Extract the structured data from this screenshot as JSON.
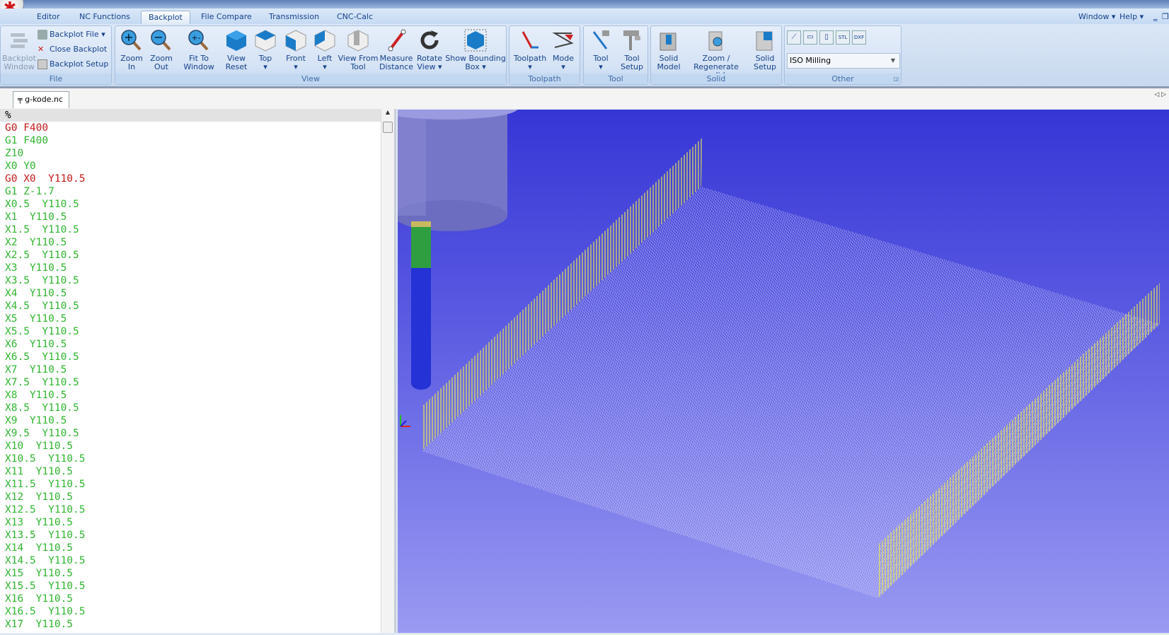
{
  "ribbon_tabs": [
    {
      "label": "Editor"
    },
    {
      "label": "NC Functions"
    },
    {
      "label": "Backplot"
    },
    {
      "label": "File Compare"
    },
    {
      "label": "Transmission"
    },
    {
      "label": "CNC-Calc"
    }
  ],
  "active_tab": "Backplot",
  "menu_right": {
    "window": "Window",
    "help": "Help"
  },
  "file_group": {
    "label": "File",
    "backplot_window": "Backplot Window",
    "backplot_file": "Backplot File",
    "close_backplot": "Close Backplot",
    "backplot_setup": "Backplot Setup"
  },
  "view_group": {
    "label": "View",
    "buttons": [
      {
        "label": "Zoom In"
      },
      {
        "label": "Zoom Out"
      },
      {
        "label": "Fit To Window"
      },
      {
        "label": "View Reset"
      },
      {
        "label": "Top"
      },
      {
        "label": "Front"
      },
      {
        "label": "Left"
      },
      {
        "label": "View From Tool"
      },
      {
        "label": "Measure Distance"
      },
      {
        "label": "Rotate View"
      },
      {
        "label": "Show Bounding Box"
      }
    ]
  },
  "toolpath_group": {
    "label": "Toolpath",
    "buttons": [
      {
        "label": "Toolpath"
      },
      {
        "label": "Mode"
      }
    ]
  },
  "tool_group": {
    "label": "Tool",
    "buttons": [
      {
        "label": "Tool"
      },
      {
        "label": "Tool Setup"
      }
    ]
  },
  "solid_group": {
    "label": "Solid",
    "buttons": [
      {
        "label": "Solid Model"
      },
      {
        "label": "Zoom / Regenerate solid"
      },
      {
        "label": "Solid Setup"
      }
    ]
  },
  "other_group": {
    "label": "Other",
    "mode_select": "ISO Milling",
    "icons": [
      "line-icon",
      "box-icon",
      "page-icon",
      "stl-icon",
      "dxf-icon"
    ]
  },
  "document_tab": "g-kode.nc",
  "colors": {
    "rapid": "#c41a1a",
    "feed": "#2fb52f",
    "viewport_top": "#3636d6",
    "viewport_bottom": "#9a9af2",
    "wall": "#e8e850"
  },
  "code_lines": [
    {
      "text": "%",
      "type": "plain"
    },
    {
      "text": "G0 F400",
      "type": "rapid"
    },
    {
      "text": "G1 F400",
      "type": "feed"
    },
    {
      "text": "Z10",
      "type": "feed"
    },
    {
      "text": "X0 Y0",
      "type": "feed"
    },
    {
      "text": "G0 X0  Y110.5",
      "type": "rapid"
    },
    {
      "text": "G1 Z-1.7",
      "type": "feed"
    },
    {
      "text": "X0.5  Y110.5",
      "type": "feed"
    },
    {
      "text": "X1  Y110.5",
      "type": "feed"
    },
    {
      "text": "X1.5  Y110.5",
      "type": "feed"
    },
    {
      "text": "X2  Y110.5",
      "type": "feed"
    },
    {
      "text": "X2.5  Y110.5",
      "type": "feed"
    },
    {
      "text": "X3  Y110.5",
      "type": "feed"
    },
    {
      "text": "X3.5  Y110.5",
      "type": "feed"
    },
    {
      "text": "X4  Y110.5",
      "type": "feed"
    },
    {
      "text": "X4.5  Y110.5",
      "type": "feed"
    },
    {
      "text": "X5  Y110.5",
      "type": "feed"
    },
    {
      "text": "X5.5  Y110.5",
      "type": "feed"
    },
    {
      "text": "X6  Y110.5",
      "type": "feed"
    },
    {
      "text": "X6.5  Y110.5",
      "type": "feed"
    },
    {
      "text": "X7  Y110.5",
      "type": "feed"
    },
    {
      "text": "X7.5  Y110.5",
      "type": "feed"
    },
    {
      "text": "X8  Y110.5",
      "type": "feed"
    },
    {
      "text": "X8.5  Y110.5",
      "type": "feed"
    },
    {
      "text": "X9  Y110.5",
      "type": "feed"
    },
    {
      "text": "X9.5  Y110.5",
      "type": "feed"
    },
    {
      "text": "X10  Y110.5",
      "type": "feed"
    },
    {
      "text": "X10.5  Y110.5",
      "type": "feed"
    },
    {
      "text": "X11  Y110.5",
      "type": "feed"
    },
    {
      "text": "X11.5  Y110.5",
      "type": "feed"
    },
    {
      "text": "X12  Y110.5",
      "type": "feed"
    },
    {
      "text": "X12.5  Y110.5",
      "type": "feed"
    },
    {
      "text": "X13  Y110.5",
      "type": "feed"
    },
    {
      "text": "X13.5  Y110.5",
      "type": "feed"
    },
    {
      "text": "X14  Y110.5",
      "type": "feed"
    },
    {
      "text": "X14.5  Y110.5",
      "type": "feed"
    },
    {
      "text": "X15  Y110.5",
      "type": "feed"
    },
    {
      "text": "X15.5  Y110.5",
      "type": "feed"
    },
    {
      "text": "X16  Y110.5",
      "type": "feed"
    },
    {
      "text": "X16.5  Y110.5",
      "type": "feed"
    },
    {
      "text": "X17  Y110.5",
      "type": "feed"
    }
  ]
}
